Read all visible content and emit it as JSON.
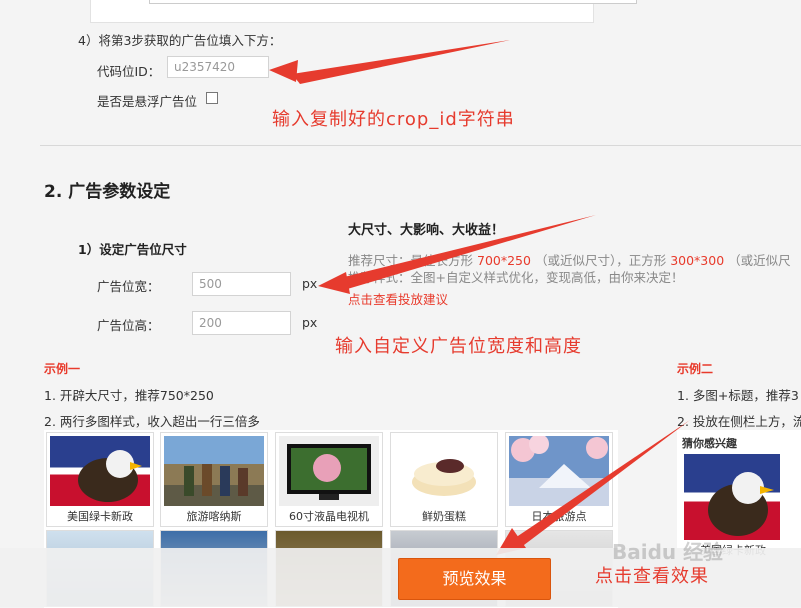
{
  "step4": {
    "label": "4）将第3步获取的广告位填入下方：",
    "code_id_label": "代码位ID：",
    "code_id_value": "u2357420",
    "floating_label": "是否是悬浮广告位"
  },
  "annotations": {
    "crop_id": "输入复制好的crop_id字符串",
    "size": "输入自定义广告位宽度和高度",
    "preview": "点击查看效果"
  },
  "section2": {
    "title": "2.   广告参数设定",
    "size_title": "1）设定广告位尺寸",
    "width_label": "广告位宽：",
    "width_value": "500",
    "height_label": "广告位高：",
    "height_value": "200",
    "unit": "px"
  },
  "promo": {
    "headline": "大尺寸、大影响、大收益！",
    "rec_prefix": "推荐尺寸：最佳长方形",
    "rec_size1": "700*250",
    "rec_mid": "（或近似尺寸），正方形",
    "rec_size2": "300*300",
    "rec_suffix": "（或近似尺",
    "style_line": "推荐样式：全图+自定义样式优化，变现高低，由你来决定！",
    "link": "点击查看投放建议"
  },
  "example1": {
    "title": "示例一",
    "line1": "1. 开辟大尺寸，推荐750*250",
    "line2": "2. 两行多图样式，收入超出一行三倍多",
    "thumbs": [
      "美国绿卡新政",
      "旅游喀纳斯",
      "60寸液晶电视机",
      "鲜奶蛋糕",
      "日本旅游点"
    ]
  },
  "example2": {
    "title": "示例二",
    "line1": "1. 多图+标题，推荐3",
    "line2": "2. 投放在侧栏上方，流",
    "guess": "猜你感兴趣",
    "thumb_caption": "美国绿卡新政"
  },
  "preview_button": "预览效果",
  "watermark": "Baidu 经验",
  "colors": {
    "accent": "#e83a2b",
    "button": "#f36b1c"
  }
}
